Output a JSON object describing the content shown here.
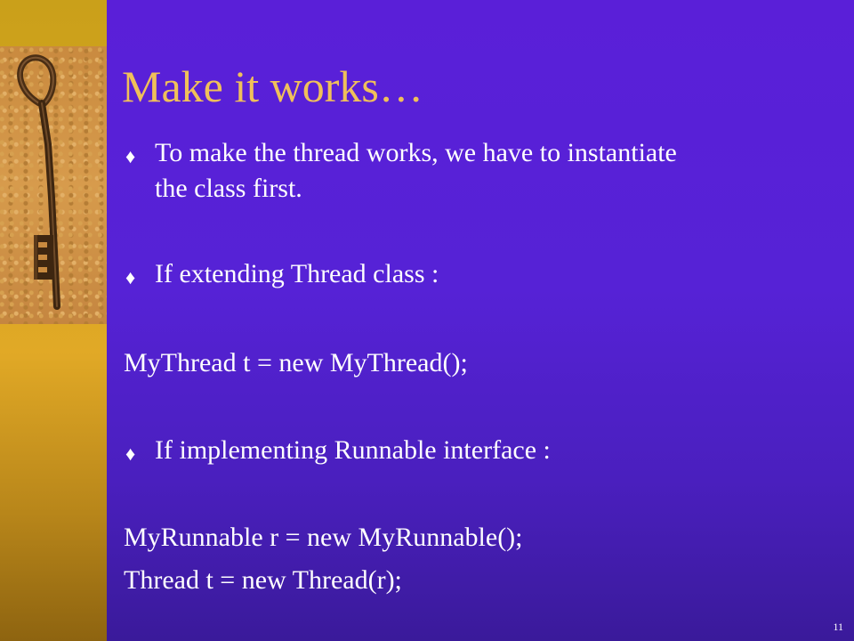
{
  "slide": {
    "title": "Make it works…",
    "bullet_marker": "♦",
    "bullets": [
      {
        "line1": "To make the thread works, we have to instantiate",
        "line2": "the class first."
      },
      {
        "line1": "If extending  Thread class :"
      },
      {
        "line1": "If implementing  Runnable interface :"
      }
    ],
    "code": {
      "thread_line": "MyThread t = new MyThread();",
      "runnable_line1": "MyRunnable r = new MyRunnable();",
      "runnable_line2": "Thread t = new Thread(r);"
    },
    "page_number": "11"
  },
  "colors": {
    "background": "#5622d6",
    "title": "#f0c05a",
    "text": "#ffffff",
    "sidebar": "#d9a722"
  },
  "icons": {
    "key_image": "antique-key-photo",
    "bullet": "diamond-bullet"
  }
}
